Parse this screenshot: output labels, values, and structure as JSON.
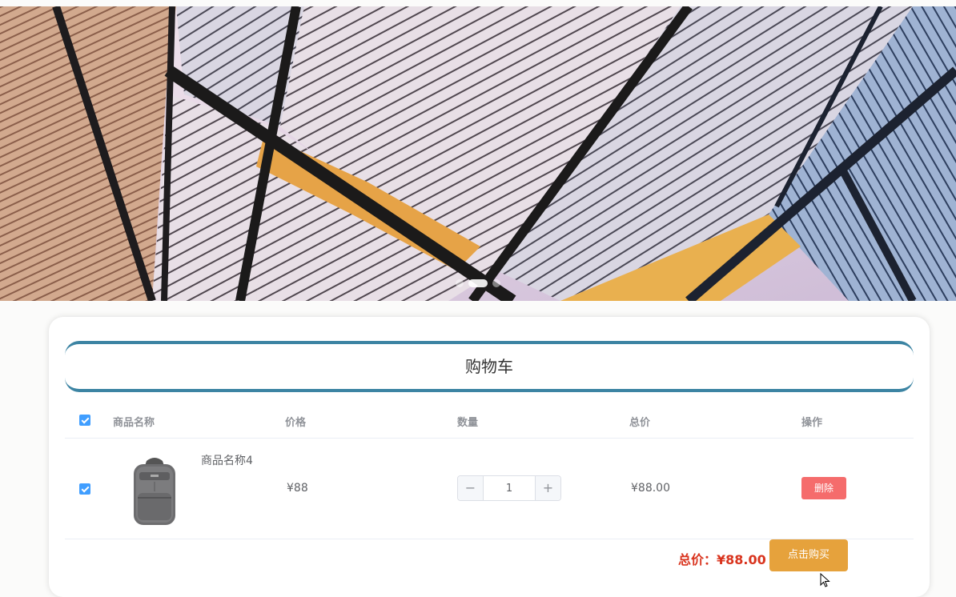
{
  "banner": {
    "indicator_count": 3,
    "active_index": 1
  },
  "cart": {
    "title": "购物车",
    "columns": [
      "商品名称",
      "价格",
      "数量",
      "总价",
      "操作"
    ],
    "items": [
      {
        "name": "商品名称4",
        "image_icon": "backpack-image",
        "price": "¥88",
        "quantity": "1",
        "subtotal": "¥88.00",
        "delete_label": "删除",
        "checked": true
      }
    ],
    "total_label": "总价：¥88.00",
    "buy_label": "点击购买"
  },
  "colors": {
    "accent": "#3c84a3",
    "delete": "#f56c6c",
    "buy": "#e6a23c",
    "total": "#d9341e",
    "checkbox": "#409eff"
  }
}
